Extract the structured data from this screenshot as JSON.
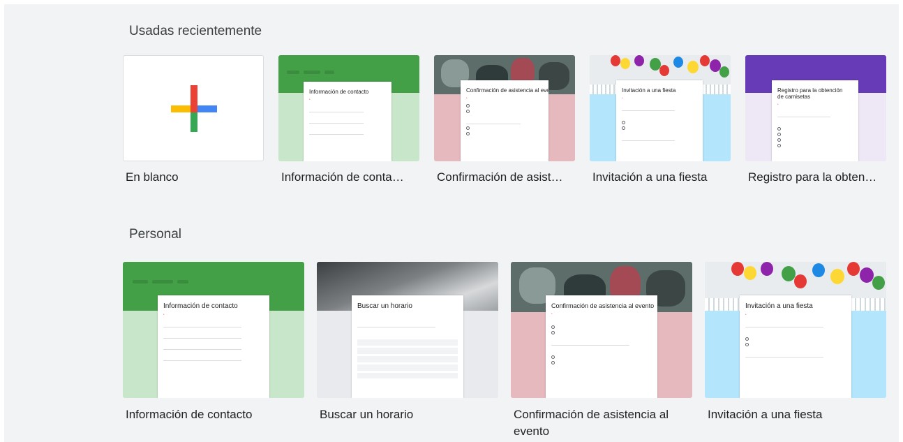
{
  "sections": {
    "recent_title": "Usadas recientemente",
    "personal_title": "Personal"
  },
  "recent": [
    {
      "label": "En blanco",
      "icon": "plus-icon",
      "colors": [
        "#ea4335",
        "#4285f4",
        "#34a853",
        "#fbbc04"
      ]
    },
    {
      "label": "Información de conta…",
      "form_title": "Información de contacto",
      "theme": "#4caf50"
    },
    {
      "label": "Confirmación de asist…",
      "form_title": "Confirmación de asistencia al evento",
      "theme": "#e0b4b8"
    },
    {
      "label": "Invitación a una fiesta",
      "form_title": "Invitación a una fiesta",
      "theme": "#b3e5fc"
    },
    {
      "label": "Registro para la obten…",
      "form_title": "Registro para la obtención de camisetas",
      "theme": "#673ab7"
    }
  ],
  "personal": [
    {
      "label": "Información de contacto",
      "form_title": "Información de contacto"
    },
    {
      "label": "Buscar un horario",
      "form_title": "Buscar un horario"
    },
    {
      "label": "Confirmación de asistencia al evento",
      "form_title": "Confirmación de asistencia al evento"
    },
    {
      "label": "Invitación a una fiesta",
      "form_title": "Invitación a una fiesta"
    }
  ]
}
